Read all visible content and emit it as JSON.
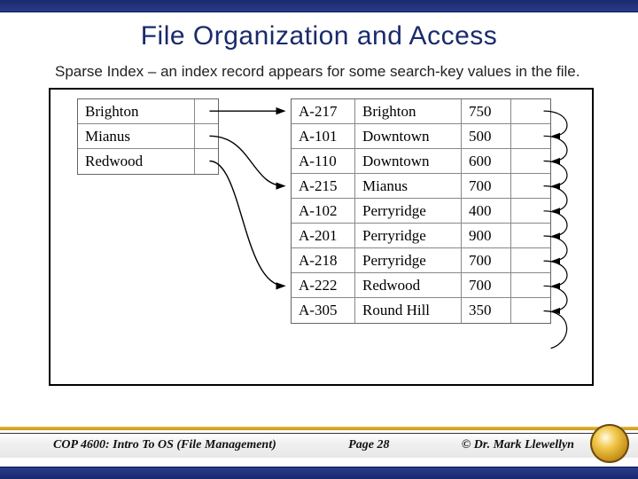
{
  "title": "File Organization and Access",
  "description": "Sparse Index – an index record appears for some search-key values in the file.",
  "index": [
    {
      "key": "Brighton"
    },
    {
      "key": "Mianus"
    },
    {
      "key": "Redwood"
    }
  ],
  "records": [
    {
      "acct": "A-217",
      "branch": "Brighton",
      "bal": "750"
    },
    {
      "acct": "A-101",
      "branch": "Downtown",
      "bal": "500"
    },
    {
      "acct": "A-110",
      "branch": "Downtown",
      "bal": "600"
    },
    {
      "acct": "A-215",
      "branch": "Mianus",
      "bal": "700"
    },
    {
      "acct": "A-102",
      "branch": "Perryridge",
      "bal": "400"
    },
    {
      "acct": "A-201",
      "branch": "Perryridge",
      "bal": "900"
    },
    {
      "acct": "A-218",
      "branch": "Perryridge",
      "bal": "700"
    },
    {
      "acct": "A-222",
      "branch": "Redwood",
      "bal": "700"
    },
    {
      "acct": "A-305",
      "branch": "Round Hill",
      "bal": "350"
    }
  ],
  "footer": {
    "course": "COP 4600: Intro To OS  (File Management)",
    "page": "Page 28",
    "author": "© Dr. Mark Llewellyn"
  }
}
